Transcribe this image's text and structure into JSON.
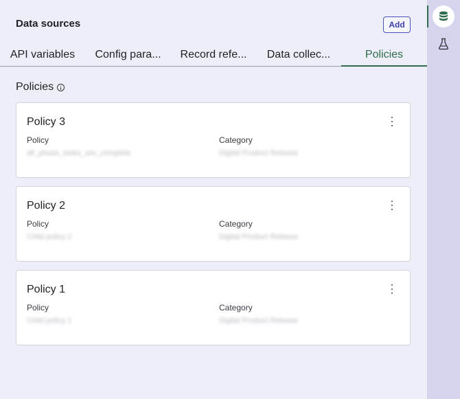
{
  "header": {
    "title": "Data sources",
    "add_label": "Add"
  },
  "tabs": [
    {
      "label": "API variables"
    },
    {
      "label": "Config para..."
    },
    {
      "label": "Record refe..."
    },
    {
      "label": "Data collec..."
    },
    {
      "label": "Policies",
      "active": true
    }
  ],
  "section": {
    "title": "Policies",
    "icon": "info-icon"
  },
  "cards": [
    {
      "title": "Policy 3",
      "policy_label": "Policy",
      "policy_value": "all_phase_tasks_are_complete",
      "category_label": "Category",
      "category_value": "Digital Product Release"
    },
    {
      "title": "Policy 2",
      "policy_label": "Policy",
      "policy_value": "Child policy 2",
      "category_label": "Category",
      "category_value": "Digital Product Release"
    },
    {
      "title": "Policy 1",
      "policy_label": "Policy",
      "policy_value": "Child policy 1",
      "category_label": "Category",
      "category_value": "Digital Product Release"
    }
  ],
  "rail": {
    "items": [
      {
        "icon": "database-icon",
        "active": true
      },
      {
        "icon": "flask-icon",
        "active": false
      }
    ]
  },
  "colors": {
    "accent_green": "#2e6b4d",
    "button_blue": "#3b3fa8",
    "background": "#eeeef8",
    "rail": "#d4d4ee"
  }
}
